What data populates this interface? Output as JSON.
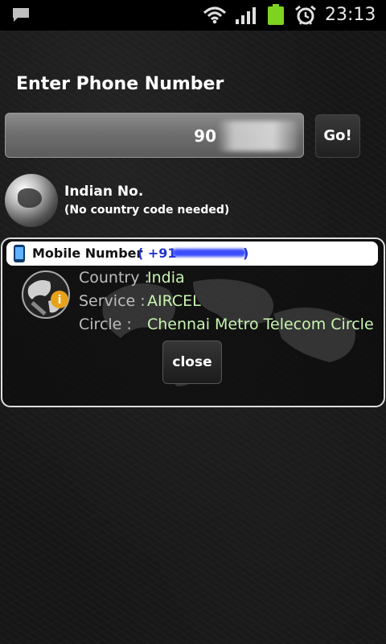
{
  "status_bar": {
    "time": "23:13",
    "icons": [
      "message-icon",
      "wifi-icon",
      "signal-icon",
      "battery-icon",
      "alarm-icon"
    ],
    "battery_color": "#7ed321"
  },
  "title": "Enter Phone Number",
  "input": {
    "value": "90"
  },
  "go_button": "Go!",
  "info": {
    "title": "Indian No.",
    "subtitle": "(No country code needed)"
  },
  "result": {
    "header_label": "Mobile Number",
    "header_number_prefix": "( +91-",
    "header_number_suffix": ")",
    "rows": [
      {
        "label": "Country :",
        "value": "India"
      },
      {
        "label": "Service :",
        "value": "AIRCEL"
      },
      {
        "label": "Circle :",
        "value": "Chennai Metro Telecom Circle"
      }
    ],
    "close_label": "close"
  },
  "colors": {
    "value_text": "#c8f5b0",
    "number_text": "#2233cc",
    "background": "#161616"
  }
}
